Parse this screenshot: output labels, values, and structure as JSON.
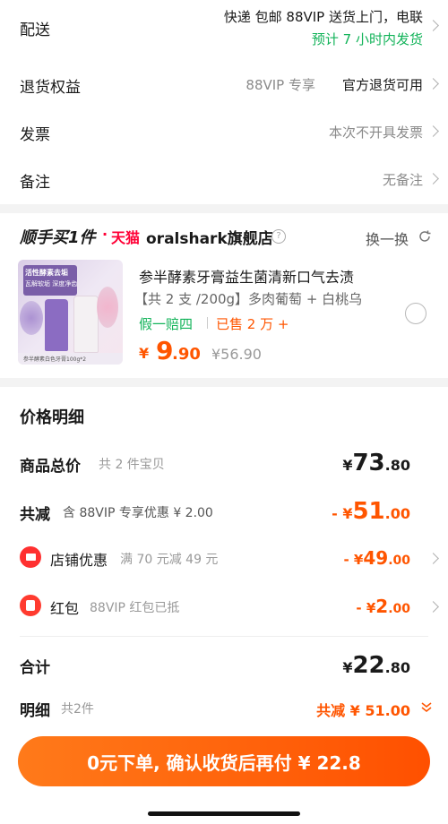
{
  "delivery": {
    "label": "配送",
    "line1": "快递 包邮 88VIP 送货上门，电联",
    "line2": "预计 7 小时内发货"
  },
  "returns": {
    "label": "退货权益",
    "vip_text": "88VIP 专享",
    "policy": "官方退货可用"
  },
  "invoice": {
    "label": "发票",
    "value": "本次不开具发票"
  },
  "remark": {
    "label": "备注",
    "value": "无备注"
  },
  "store": {
    "badge": "顺手买1件",
    "dot": "·",
    "tmall": "天猫",
    "name": "oralshark旗舰店",
    "swap": "换一换"
  },
  "product": {
    "title": "参半酵素牙膏益生菌清新口气去渍",
    "spec": "【共 2 支 /200g】多肉葡萄 + 白桃乌",
    "guarantee": "假一赔四",
    "sold": "已售 2 万 +",
    "price_symbol": "¥",
    "price_int": "9",
    "price_dec": ".90",
    "orig_price": "¥56.90",
    "img_text1": "活性酵素去垢",
    "img_text2": "瓦解软垢 深度净齿",
    "img_caption": "参半酵素白色牙膏100g*2"
  },
  "price_detail": {
    "title": "价格明细",
    "total_label": "商品总价",
    "total_sub": "共 2 件宝贝",
    "total_symbol": "¥",
    "total_int": "73",
    "total_dec": ".80",
    "discount_label": "共减",
    "discount_sub": "含 88VIP 专享优惠 ¥ 2.00",
    "discount_symbol": "- ¥",
    "discount_int": "51",
    "discount_dec": ".00",
    "shop_label": "店铺优惠",
    "shop_sub": "满 70 元减 49 元",
    "shop_symbol": "- ¥",
    "shop_int": "49",
    "shop_dec": ".00",
    "redpack_label": "红包",
    "redpack_sub": "88VIP 红包已抵",
    "redpack_symbol": "- ¥",
    "redpack_int": "2",
    "redpack_dec": ".00",
    "sum_label": "合计",
    "sum_symbol": "¥",
    "sum_int": "22",
    "sum_dec": ".80",
    "detail_label": "明细",
    "detail_sub": "共2件",
    "detail_discount": "共减 ¥ 51.00"
  },
  "pay_button": {
    "label": "0元下单, 确认收货后再付 ¥ 22.8"
  },
  "colors": {
    "accent": "#ff5500",
    "green": "#12b359",
    "tmall_red": "#ff0036"
  },
  "icons": [
    "chevron-right-icon",
    "info-icon",
    "refresh-icon",
    "shop-icon",
    "redpack-icon",
    "double-chevron-down-icon"
  ]
}
